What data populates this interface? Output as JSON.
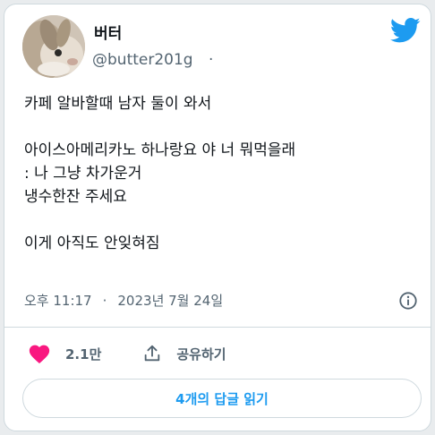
{
  "author": {
    "display_name": "버터",
    "handle": "@butter201g",
    "handle_separator": "·"
  },
  "tweet": {
    "lines": [
      "카페 알바할때 남자 둘이 와서",
      "",
      "아이스아메리카노 하나랑요 야 너 뭐먹을래",
      ": 나 그냥 차가운거",
      "냉수한잔 주세요",
      "",
      "이게 아직도 안잊혀짐"
    ]
  },
  "meta": {
    "time": "오후 11:17",
    "separator": "·",
    "date": "2023년 7월 24일"
  },
  "actions": {
    "likes": "2.1만",
    "share_label": "공유하기"
  },
  "replies_button": "4개의 답글 읽기",
  "colors": {
    "twitter_blue": "#1d9bf0",
    "heart_pink": "#f91880",
    "secondary_text": "#536471"
  },
  "icons": {
    "logo": "twitter-bird-icon",
    "like": "heart-icon",
    "share": "share-icon",
    "info": "info-icon"
  }
}
